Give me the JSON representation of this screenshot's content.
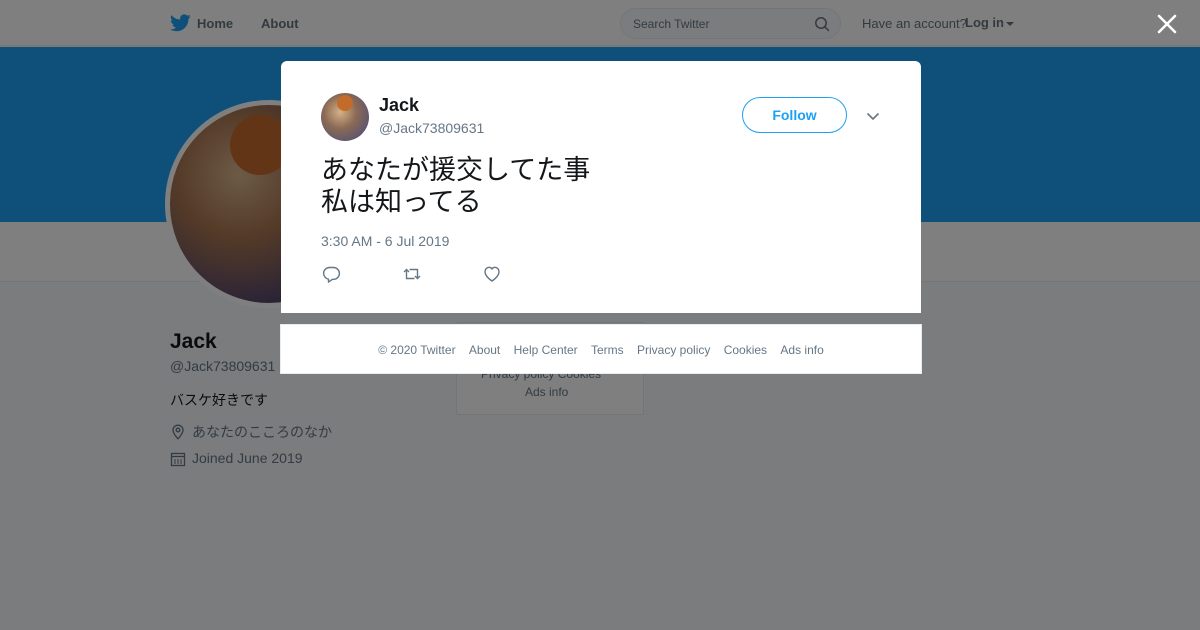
{
  "topbar": {
    "home_label": "Home",
    "about_label": "About",
    "search_placeholder": "Search Twitter",
    "have_account": "Have an account?",
    "login_label": "Log in"
  },
  "profile": {
    "name": "Jack",
    "handle": "@Jack73809631",
    "bio": "バスケ好きです",
    "location": "あなたのこころのなか",
    "joined": "Joined June 2019"
  },
  "side_footer": {
    "line1": "Privacy policy  Cookies",
    "line2": "Ads info"
  },
  "tweet": {
    "author_name": "Jack",
    "author_handle": "@Jack73809631",
    "follow_label": "Follow",
    "text": "あなたが援交してた事\n私は知ってる",
    "timestamp": "3:30 AM - 6 Jul 2019"
  },
  "footer": {
    "copyright": "© 2020 Twitter",
    "links": [
      "About",
      "Help Center",
      "Terms",
      "Privacy policy",
      "Cookies",
      "Ads info"
    ]
  },
  "colors": {
    "brand": "#1da1f2",
    "secondary_text": "#657786",
    "overlay": "rgba(0,0,0,0.5)"
  },
  "icons": {
    "logo": "twitter-bird-icon",
    "search": "search-icon",
    "close": "close-icon",
    "chevron": "chevron-down-icon",
    "reply": "reply-icon",
    "retweet": "retweet-icon",
    "like": "heart-icon",
    "location": "location-pin-icon",
    "calendar": "calendar-icon"
  }
}
